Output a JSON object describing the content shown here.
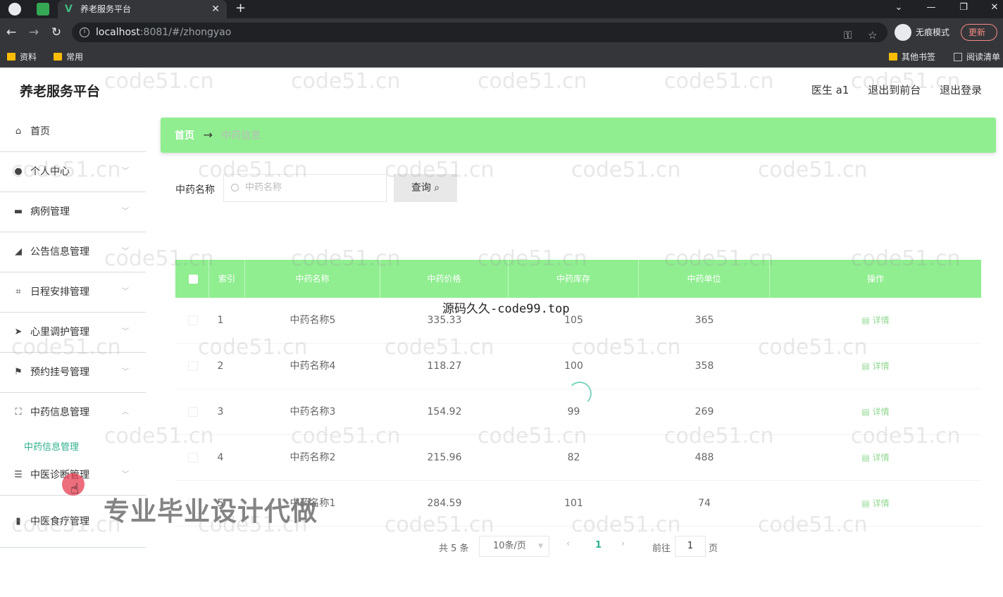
{
  "browser": {
    "tab_title": "养老服务平台",
    "url_host": "localhost",
    "url_path": ":8081/#/zhongyao",
    "incognito_label": "无痕模式",
    "update_label": "更新",
    "bookmarks": [
      "资料",
      "常用"
    ],
    "bookmarks_right": [
      "其他书签",
      "阅读清单"
    ]
  },
  "header": {
    "brand": "养老服务平台",
    "user": "医生 a1",
    "to_front": "退出到前台",
    "logout": "退出登录"
  },
  "sidebar": {
    "items": [
      {
        "label": "首页",
        "icon": "home-icon"
      },
      {
        "label": "个人中心",
        "icon": "user-icon"
      },
      {
        "label": "病例管理",
        "icon": "folder-icon"
      },
      {
        "label": "公告信息管理",
        "icon": "announcement-icon"
      },
      {
        "label": "日程安排管理",
        "icon": "crop-icon"
      },
      {
        "label": "心里调护管理",
        "icon": "send-icon"
      },
      {
        "label": "预约挂号管理",
        "icon": "flag-icon"
      },
      {
        "label": "中药信息管理",
        "icon": "frame-icon"
      },
      {
        "label": "中医诊断管理",
        "icon": "list-icon"
      },
      {
        "label": "中医食疗管理",
        "icon": "bar-chart-icon"
      }
    ],
    "sub_item": "中药信息管理"
  },
  "breadcrumb": {
    "home": "首页",
    "sep": "→",
    "current": "中药信息"
  },
  "search": {
    "label": "中药名称",
    "placeholder": "中药名称",
    "button": "查询"
  },
  "table": {
    "headers": [
      "索引",
      "中药名称",
      "中药价格",
      "中药库存",
      "中药单位",
      "操作"
    ],
    "rows": [
      {
        "index": "1",
        "name": "中药名称5",
        "price": "335.33",
        "stock": "105",
        "unit": "365",
        "action": "详情"
      },
      {
        "index": "2",
        "name": "中药名称4",
        "price": "118.27",
        "stock": "100",
        "unit": "358",
        "action": "详情"
      },
      {
        "index": "3",
        "name": "中药名称3",
        "price": "154.92",
        "stock": "99",
        "unit": "269",
        "action": "详情"
      },
      {
        "index": "4",
        "name": "中药名称2",
        "price": "215.96",
        "stock": "82",
        "unit": "488",
        "action": "详情"
      },
      {
        "index": "5",
        "name": "中药名称1",
        "price": "284.59",
        "stock": "101",
        "unit": "74",
        "action": "详情"
      }
    ]
  },
  "pagination": {
    "total": "共 5 条",
    "page_size": "10条/页",
    "current": "1",
    "goto": "前往",
    "goto_value": "1",
    "page_suffix": "页"
  },
  "overlays": {
    "watermark": "code51.cn",
    "code_text": "源码久久-code99.top",
    "promo_text": "专业毕业设计代做"
  }
}
